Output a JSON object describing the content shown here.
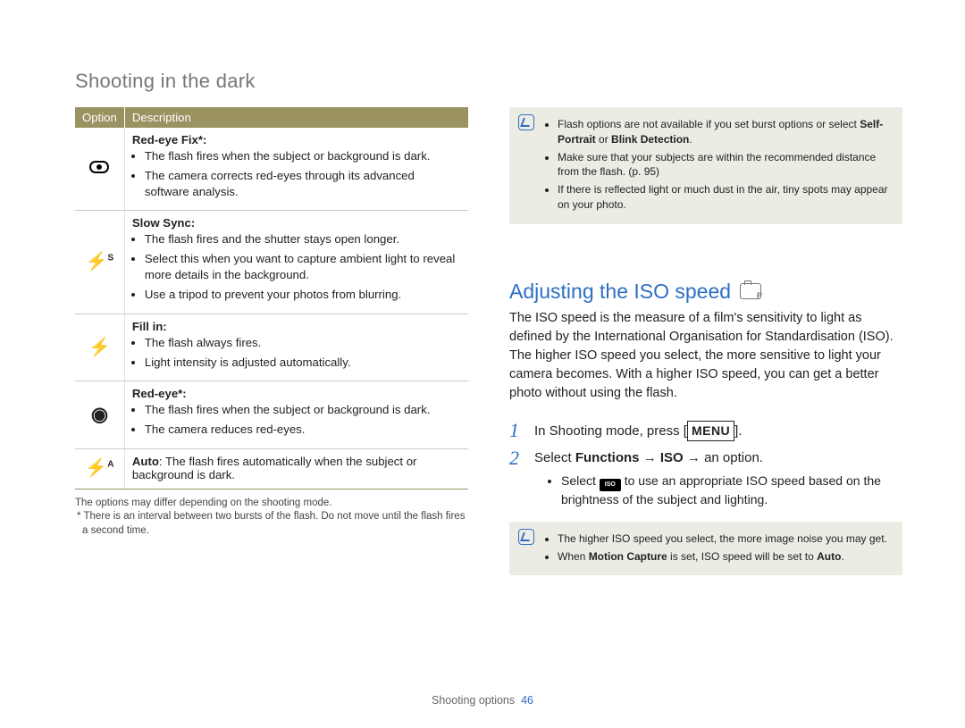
{
  "header": {
    "title": "Shooting in the dark"
  },
  "table": {
    "th_option": "Option",
    "th_desc": "Description",
    "rows": [
      {
        "icon_name": "red-eye-fix",
        "title": "Red-eye Fix*:",
        "bullets": [
          "The flash fires when the subject or background is dark.",
          "The camera corrects red-eyes through its advanced software analysis."
        ]
      },
      {
        "icon_name": "slow-sync",
        "title": "Slow Sync:",
        "bullets": [
          "The flash fires and the shutter stays open longer.",
          "Select this when you want to capture ambient light to reveal more details in the background.",
          "Use a tripod to prevent your photos from blurring."
        ]
      },
      {
        "icon_name": "fill-in",
        "title": "Fill in:",
        "bullets": [
          "The flash always fires.",
          "Light intensity is adjusted automatically."
        ]
      },
      {
        "icon_name": "red-eye",
        "title": "Red-eye*:",
        "bullets": [
          "The flash fires when the subject or background is dark.",
          "The camera reduces red-eyes."
        ]
      },
      {
        "icon_name": "auto",
        "title": "Auto",
        "inline_after_title": ": The flash fires automatically when the subject or background is dark."
      }
    ]
  },
  "footnotes": {
    "line1": "The options may differ depending on the shooting mode.",
    "line2": "* There is an interval between two bursts of the flash. Do not move until the flash fires a second time."
  },
  "note1": {
    "bullets_pre": "Flash options are not available if you set burst options or select ",
    "b1a": "Self-Portrait",
    "or": " or ",
    "b1b": "Blink Detection",
    "b1c": ".",
    "b2": "Make sure that your subjects are within the recommended distance from the flash. (p. 95)",
    "b3": "If there is reflected light or much dust in the air, tiny spots may appear on your photo."
  },
  "section": {
    "title": "Adjusting the ISO speed",
    "body": "The ISO speed is the measure of a film's sensitivity to light as defined by the International Organisation for Standardisation (ISO). The higher ISO speed you select, the more sensitive to light your camera becomes. With a higher ISO speed, you can get a better photo without using the flash."
  },
  "steps": {
    "s1_pre": "In Shooting mode, press [",
    "s1_menu": "MENU",
    "s1_post": "].",
    "s2_pre": "Select ",
    "s2_b1": "Functions",
    "s2_arrow1": " → ",
    "s2_b2": "ISO",
    "s2_arrow2": " → ",
    "s2_post": "an option.",
    "s2_sub_pre": "Select ",
    "s2_sub_post": " to use an appropriate ISO speed based on the brightness of the subject and lighting."
  },
  "note2": {
    "b1": "The higher ISO speed you select, the more image noise you may get.",
    "b2_pre": "When ",
    "b2_b": "Motion Capture",
    "b2_mid": " is set, ISO speed will be set to ",
    "b2_b2": "Auto",
    "b2_post": "."
  },
  "footer": {
    "label": "Shooting options",
    "page": "46"
  }
}
